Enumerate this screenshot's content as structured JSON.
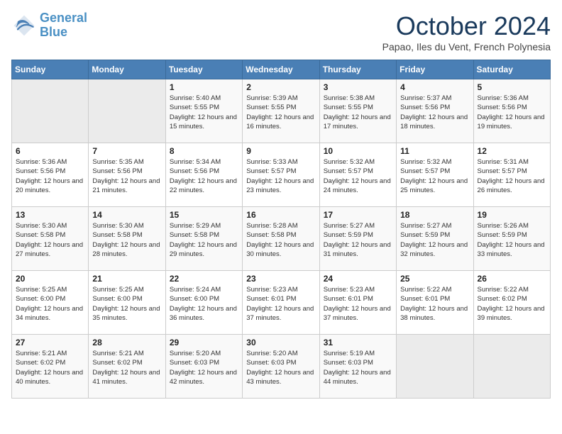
{
  "header": {
    "logo_line1": "General",
    "logo_line2": "Blue",
    "month_title": "October 2024",
    "subtitle": "Papao, Iles du Vent, French Polynesia"
  },
  "weekdays": [
    "Sunday",
    "Monday",
    "Tuesday",
    "Wednesday",
    "Thursday",
    "Friday",
    "Saturday"
  ],
  "weeks": [
    [
      {
        "day": "",
        "empty": true
      },
      {
        "day": "",
        "empty": true
      },
      {
        "day": "1",
        "sunrise": "Sunrise: 5:40 AM",
        "sunset": "Sunset: 5:55 PM",
        "daylight": "Daylight: 12 hours and 15 minutes."
      },
      {
        "day": "2",
        "sunrise": "Sunrise: 5:39 AM",
        "sunset": "Sunset: 5:55 PM",
        "daylight": "Daylight: 12 hours and 16 minutes."
      },
      {
        "day": "3",
        "sunrise": "Sunrise: 5:38 AM",
        "sunset": "Sunset: 5:55 PM",
        "daylight": "Daylight: 12 hours and 17 minutes."
      },
      {
        "day": "4",
        "sunrise": "Sunrise: 5:37 AM",
        "sunset": "Sunset: 5:56 PM",
        "daylight": "Daylight: 12 hours and 18 minutes."
      },
      {
        "day": "5",
        "sunrise": "Sunrise: 5:36 AM",
        "sunset": "Sunset: 5:56 PM",
        "daylight": "Daylight: 12 hours and 19 minutes."
      }
    ],
    [
      {
        "day": "6",
        "sunrise": "Sunrise: 5:36 AM",
        "sunset": "Sunset: 5:56 PM",
        "daylight": "Daylight: 12 hours and 20 minutes."
      },
      {
        "day": "7",
        "sunrise": "Sunrise: 5:35 AM",
        "sunset": "Sunset: 5:56 PM",
        "daylight": "Daylight: 12 hours and 21 minutes."
      },
      {
        "day": "8",
        "sunrise": "Sunrise: 5:34 AM",
        "sunset": "Sunset: 5:56 PM",
        "daylight": "Daylight: 12 hours and 22 minutes."
      },
      {
        "day": "9",
        "sunrise": "Sunrise: 5:33 AM",
        "sunset": "Sunset: 5:57 PM",
        "daylight": "Daylight: 12 hours and 23 minutes."
      },
      {
        "day": "10",
        "sunrise": "Sunrise: 5:32 AM",
        "sunset": "Sunset: 5:57 PM",
        "daylight": "Daylight: 12 hours and 24 minutes."
      },
      {
        "day": "11",
        "sunrise": "Sunrise: 5:32 AM",
        "sunset": "Sunset: 5:57 PM",
        "daylight": "Daylight: 12 hours and 25 minutes."
      },
      {
        "day": "12",
        "sunrise": "Sunrise: 5:31 AM",
        "sunset": "Sunset: 5:57 PM",
        "daylight": "Daylight: 12 hours and 26 minutes."
      }
    ],
    [
      {
        "day": "13",
        "sunrise": "Sunrise: 5:30 AM",
        "sunset": "Sunset: 5:58 PM",
        "daylight": "Daylight: 12 hours and 27 minutes."
      },
      {
        "day": "14",
        "sunrise": "Sunrise: 5:30 AM",
        "sunset": "Sunset: 5:58 PM",
        "daylight": "Daylight: 12 hours and 28 minutes."
      },
      {
        "day": "15",
        "sunrise": "Sunrise: 5:29 AM",
        "sunset": "Sunset: 5:58 PM",
        "daylight": "Daylight: 12 hours and 29 minutes."
      },
      {
        "day": "16",
        "sunrise": "Sunrise: 5:28 AM",
        "sunset": "Sunset: 5:58 PM",
        "daylight": "Daylight: 12 hours and 30 minutes."
      },
      {
        "day": "17",
        "sunrise": "Sunrise: 5:27 AM",
        "sunset": "Sunset: 5:59 PM",
        "daylight": "Daylight: 12 hours and 31 minutes."
      },
      {
        "day": "18",
        "sunrise": "Sunrise: 5:27 AM",
        "sunset": "Sunset: 5:59 PM",
        "daylight": "Daylight: 12 hours and 32 minutes."
      },
      {
        "day": "19",
        "sunrise": "Sunrise: 5:26 AM",
        "sunset": "Sunset: 5:59 PM",
        "daylight": "Daylight: 12 hours and 33 minutes."
      }
    ],
    [
      {
        "day": "20",
        "sunrise": "Sunrise: 5:25 AM",
        "sunset": "Sunset: 6:00 PM",
        "daylight": "Daylight: 12 hours and 34 minutes."
      },
      {
        "day": "21",
        "sunrise": "Sunrise: 5:25 AM",
        "sunset": "Sunset: 6:00 PM",
        "daylight": "Daylight: 12 hours and 35 minutes."
      },
      {
        "day": "22",
        "sunrise": "Sunrise: 5:24 AM",
        "sunset": "Sunset: 6:00 PM",
        "daylight": "Daylight: 12 hours and 36 minutes."
      },
      {
        "day": "23",
        "sunrise": "Sunrise: 5:23 AM",
        "sunset": "Sunset: 6:01 PM",
        "daylight": "Daylight: 12 hours and 37 minutes."
      },
      {
        "day": "24",
        "sunrise": "Sunrise: 5:23 AM",
        "sunset": "Sunset: 6:01 PM",
        "daylight": "Daylight: 12 hours and 37 minutes."
      },
      {
        "day": "25",
        "sunrise": "Sunrise: 5:22 AM",
        "sunset": "Sunset: 6:01 PM",
        "daylight": "Daylight: 12 hours and 38 minutes."
      },
      {
        "day": "26",
        "sunrise": "Sunrise: 5:22 AM",
        "sunset": "Sunset: 6:02 PM",
        "daylight": "Daylight: 12 hours and 39 minutes."
      }
    ],
    [
      {
        "day": "27",
        "sunrise": "Sunrise: 5:21 AM",
        "sunset": "Sunset: 6:02 PM",
        "daylight": "Daylight: 12 hours and 40 minutes."
      },
      {
        "day": "28",
        "sunrise": "Sunrise: 5:21 AM",
        "sunset": "Sunset: 6:02 PM",
        "daylight": "Daylight: 12 hours and 41 minutes."
      },
      {
        "day": "29",
        "sunrise": "Sunrise: 5:20 AM",
        "sunset": "Sunset: 6:03 PM",
        "daylight": "Daylight: 12 hours and 42 minutes."
      },
      {
        "day": "30",
        "sunrise": "Sunrise: 5:20 AM",
        "sunset": "Sunset: 6:03 PM",
        "daylight": "Daylight: 12 hours and 43 minutes."
      },
      {
        "day": "31",
        "sunrise": "Sunrise: 5:19 AM",
        "sunset": "Sunset: 6:03 PM",
        "daylight": "Daylight: 12 hours and 44 minutes."
      },
      {
        "day": "",
        "empty": true
      },
      {
        "day": "",
        "empty": true
      }
    ]
  ]
}
